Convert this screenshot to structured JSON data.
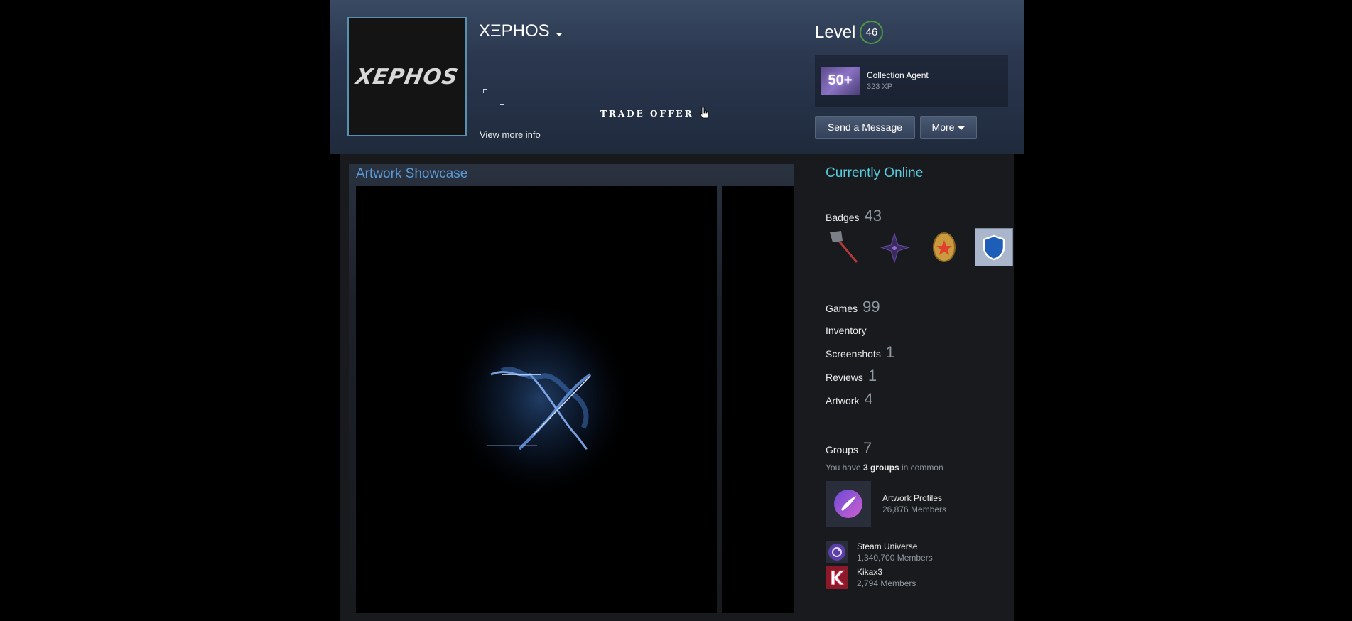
{
  "profile": {
    "avatar_text": "XEPHOS",
    "persona_name": "XΞPHOS",
    "trade_offer": "TRADE OFFER",
    "view_more": "View more info"
  },
  "level": {
    "label": "Level",
    "value": "46"
  },
  "favorite_badge": {
    "icon_text": "50+",
    "name": "Collection Agent",
    "xp": "323 XP"
  },
  "buttons": {
    "send_message": "Send a Message",
    "more": "More"
  },
  "showcase": {
    "title": "Artwork Showcase"
  },
  "sidebar": {
    "status": "Currently Online",
    "badges": {
      "label": "Badges",
      "count": "43"
    },
    "games": {
      "label": "Games",
      "count": "99"
    },
    "inventory": {
      "label": "Inventory"
    },
    "screenshots": {
      "label": "Screenshots",
      "count": "1"
    },
    "reviews": {
      "label": "Reviews",
      "count": "1"
    },
    "artwork": {
      "label": "Artwork",
      "count": "4"
    },
    "groups": {
      "label": "Groups",
      "count": "7"
    },
    "groups_common": {
      "prefix": "You have",
      "count": "3 groups",
      "suffix": "in common"
    },
    "group_list": [
      {
        "name": "Artwork Profiles",
        "members": "26,876 Members"
      },
      {
        "name": "Steam Universe",
        "members": "1,340,700 Members"
      },
      {
        "name": "Kikax3",
        "members": "2,794 Members"
      }
    ]
  },
  "colors": {
    "accent_blue": "#5a9ad6",
    "online_cyan": "#57cbde",
    "level_green": "#4c9b44"
  }
}
